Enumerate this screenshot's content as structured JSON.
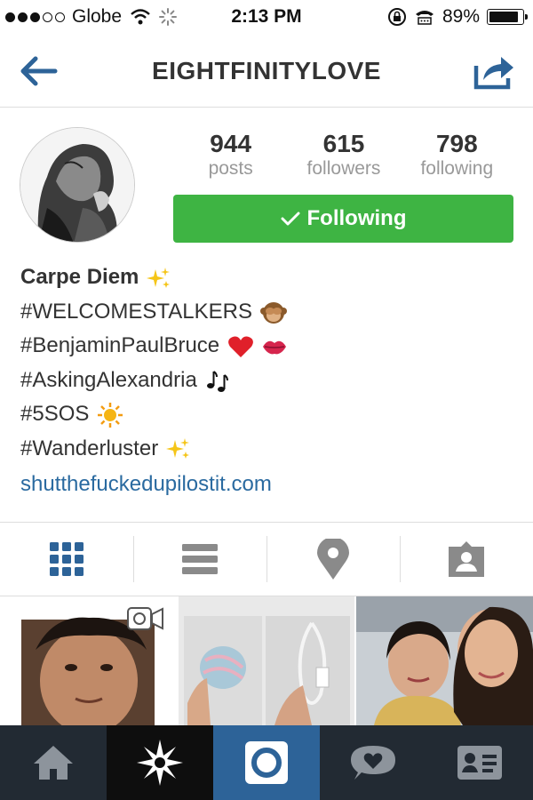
{
  "status_bar": {
    "carrier": "Globe",
    "time": "2:13 PM",
    "battery_percent": "89%",
    "battery_level": 0.89,
    "signal_bars": 3
  },
  "header": {
    "title": "EIGHTFINITYLOVE",
    "back_icon": "back-arrow-icon",
    "share_icon": "share-icon"
  },
  "profile": {
    "stats": [
      {
        "count": "944",
        "label": "posts"
      },
      {
        "count": "615",
        "label": "followers"
      },
      {
        "count": "798",
        "label": "following"
      }
    ],
    "follow_button_label": "Following",
    "bio": {
      "name": "Carpe Diem",
      "lines": [
        "#WELCOMESTALKERS",
        "#BenjaminPaulBruce",
        "#AskingAlexandria",
        "#5SOS",
        "#Wanderluster"
      ],
      "website": "shutthefuckedupilostit.com"
    }
  },
  "tabs": [
    {
      "icon": "grid-icon",
      "active": true
    },
    {
      "icon": "list-icon",
      "active": false
    },
    {
      "icon": "location-pin-icon",
      "active": false
    },
    {
      "icon": "tagged-person-icon",
      "active": false
    }
  ],
  "bottom_nav": [
    {
      "icon": "home-icon"
    },
    {
      "icon": "explore-star-icon"
    },
    {
      "icon": "camera-icon",
      "active": true
    },
    {
      "icon": "activity-heart-icon"
    },
    {
      "icon": "profile-card-icon"
    }
  ],
  "colors": {
    "accent_blue": "#2d6398",
    "follow_green": "#3eb443",
    "link_blue": "#2a6aa0"
  }
}
